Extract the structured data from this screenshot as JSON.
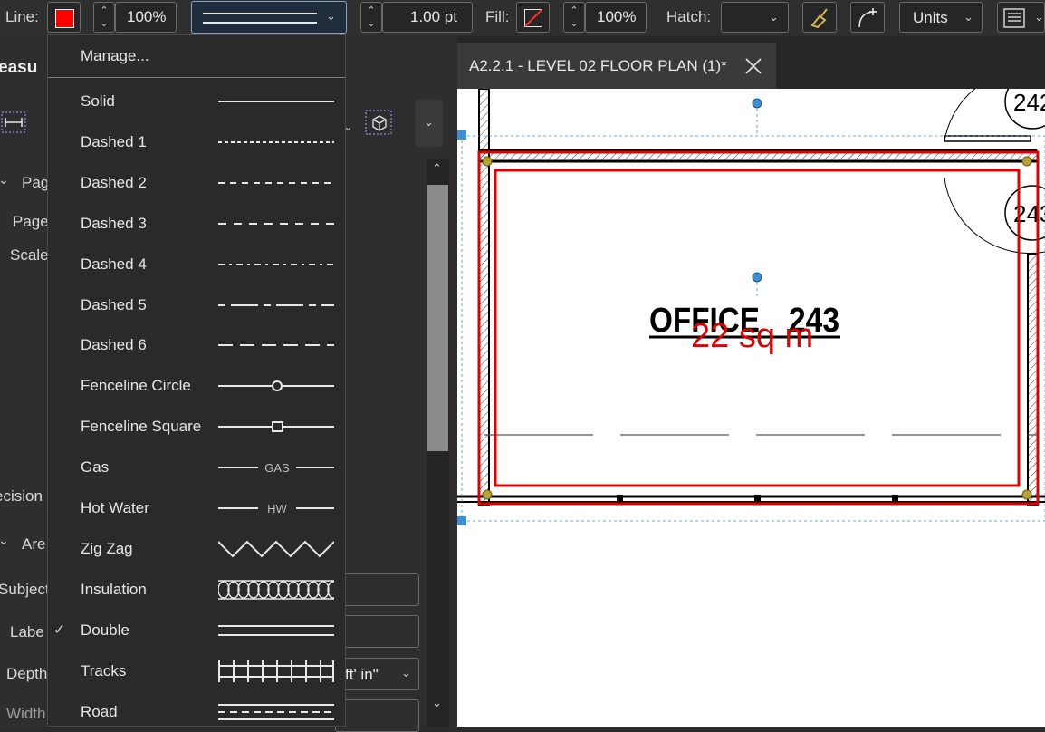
{
  "toolbar": {
    "line_label": "Line:",
    "line_color": "#ff0000",
    "line_opacity": "100%",
    "line_width": "1.00 pt",
    "fill_label": "Fill:",
    "fill_opacity": "100%",
    "hatch_label": "Hatch:",
    "units_label": "Units"
  },
  "left_panel": {
    "title_fragment": "easu",
    "labels": [
      "Pag",
      "Page",
      "Scale",
      "ecision",
      "Are",
      "Subject",
      "Labe",
      "Depth",
      "Width"
    ],
    "depth_unit": "ft' in\""
  },
  "linestyle_menu": {
    "manage_label": "Manage...",
    "selected": "Double",
    "items": [
      {
        "label": "Solid",
        "style": "solid"
      },
      {
        "label": "Dashed 1",
        "style": "dashed1"
      },
      {
        "label": "Dashed 2",
        "style": "dashed2"
      },
      {
        "label": "Dashed 3",
        "style": "dashed3"
      },
      {
        "label": "Dashed 4",
        "style": "dashed4"
      },
      {
        "label": "Dashed 5",
        "style": "dashed5"
      },
      {
        "label": "Dashed 6",
        "style": "dashed6"
      },
      {
        "label": "Fenceline Circle",
        "style": "fence-circle"
      },
      {
        "label": "Fenceline Square",
        "style": "fence-square"
      },
      {
        "label": "Gas",
        "style": "text",
        "inline_text": "GAS"
      },
      {
        "label": "Hot Water",
        "style": "text",
        "inline_text": "HW"
      },
      {
        "label": "Zig Zag",
        "style": "zigzag"
      },
      {
        "label": "Insulation",
        "style": "insulation"
      },
      {
        "label": "Double",
        "style": "double"
      },
      {
        "label": "Tracks",
        "style": "tracks"
      },
      {
        "label": "Road",
        "style": "road"
      }
    ]
  },
  "document": {
    "tab_title": "A2.2.1 - LEVEL 02 FLOOR PLAN (1)*",
    "room_name": "OFFICE",
    "room_number": "243",
    "area_text": "22 sq m",
    "tag_top": "242",
    "tag_right": "243",
    "markup_color": "#e00000"
  }
}
